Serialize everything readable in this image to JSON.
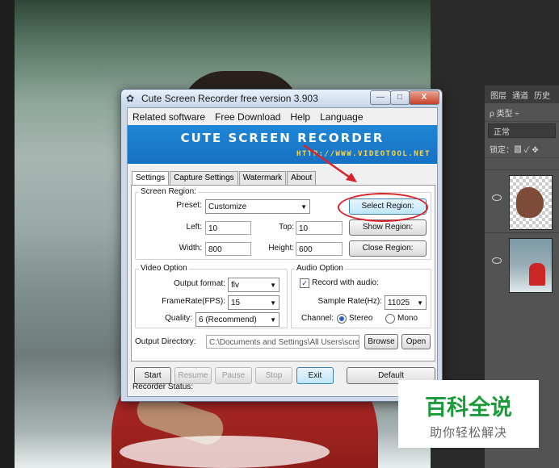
{
  "window": {
    "title": "Cute Screen Recorder free version 3.903",
    "controls": [
      "—",
      "□",
      "X"
    ]
  },
  "menu": [
    "Related software",
    "Free Download",
    "Help",
    "Language"
  ],
  "banner": {
    "title": "CUTE SCREEN RECORDER",
    "url": "HTTP://WWW.VIDEOTOOL.NET"
  },
  "tabs": [
    "Settings",
    "Capture Settings",
    "Watermark",
    "About"
  ],
  "screen_region": {
    "title": "Screen Region:",
    "preset_label": "Preset:",
    "preset_value": "Customize",
    "left_label": "Left:",
    "left_value": "10",
    "top_label": "Top:",
    "top_value": "10",
    "width_label": "Width:",
    "width_value": "800",
    "height_label": "Height:",
    "height_value": "600",
    "select_region": "Select Region:",
    "show_region": "Show Region:",
    "close_region": "Close Region:"
  },
  "video_option": {
    "title": "Video Option",
    "output_format_label": "Output format:",
    "output_format_value": "flv",
    "fps_label": "FrameRate(FPS):",
    "fps_value": "15",
    "quality_label": "Quality:",
    "quality_value": "6 (Recommend)"
  },
  "audio_option": {
    "title": "Audio Option",
    "record_audio_label": "Record with audio:",
    "record_audio_checked": true,
    "sample_rate_label": "Sample Rate(Hz):",
    "sample_rate_value": "11025",
    "channel_label": "Channel:",
    "stereo": "Stereo",
    "mono": "Mono",
    "selected_channel": "Stereo"
  },
  "output": {
    "label": "Output Directory:",
    "value": "C:\\Documents and Settings\\All Users\\scre",
    "browse": "Browse",
    "open": "Open"
  },
  "controls": {
    "start": "Start",
    "resume": "Resume",
    "pause": "Pause",
    "stop": "Stop",
    "exit": "Exit",
    "default": "Default"
  },
  "status": "Recorder Status:",
  "photoshop": {
    "tabs": [
      "图层",
      "通道",
      "历史"
    ],
    "filter": "ρ 类型 ÷",
    "blend_mode": "正常",
    "lock_label": "锁定：▩ ✓ ✥"
  },
  "watermark": {
    "title": "百科全说",
    "subtitle": "助你轻松解决"
  },
  "colors": {
    "banner": "#1f86d6",
    "annotation_red": "#d8232a",
    "watermark_green": "#1b9b3a"
  }
}
